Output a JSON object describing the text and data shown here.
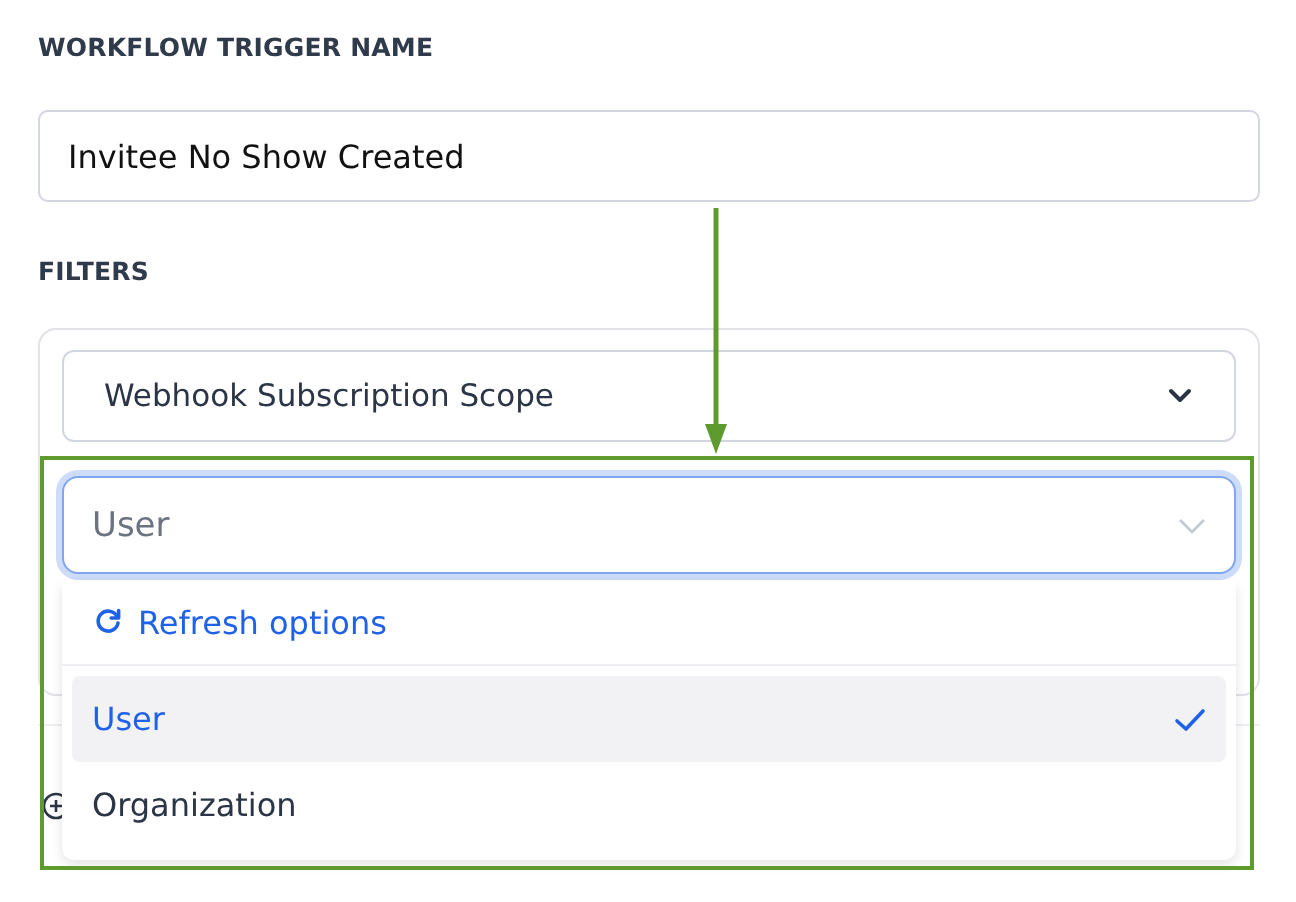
{
  "trigger_name": {
    "label": "WORKFLOW TRIGGER NAME",
    "value": "Invitee No Show Created"
  },
  "filters": {
    "label": "FILTERS",
    "field": {
      "value": "Webhook Subscription Scope"
    }
  },
  "dropdown": {
    "placeholder": "User",
    "focused": true,
    "refresh_label": "Refresh options",
    "options": [
      {
        "label": "User",
        "selected": true
      },
      {
        "label": "Organization",
        "selected": false
      }
    ]
  }
}
